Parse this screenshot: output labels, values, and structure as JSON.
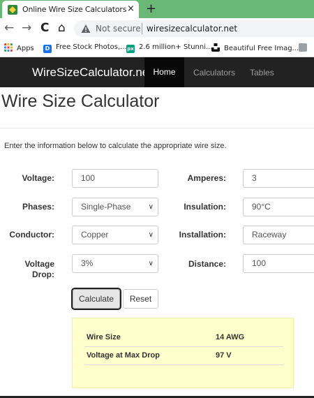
{
  "browser": {
    "tab_title": "Online Wire Size Calculators & Ta",
    "tab_close": "×",
    "new_tab": "+",
    "nav": {
      "back": "←",
      "forward": "→",
      "reload": "C",
      "home": "⌂"
    },
    "security_label": "Not secure",
    "url": "wiresizecalculator.net",
    "bookmarks": [
      {
        "label": "Apps",
        "icon": "apps-grid-icon",
        "color": "#e37400"
      },
      {
        "label": "Free Stock Photos,...",
        "icon": "d-favicon",
        "color": "#1a73e8"
      },
      {
        "label": "2.6 million+ Stunni...",
        "icon": "px-favicon",
        "color": "#05a081"
      },
      {
        "label": "Beautiful Free Imag...",
        "icon": "unsplash-favicon",
        "color": "#111111"
      }
    ]
  },
  "site": {
    "brand": "WireSizeCalculator.net",
    "nav": {
      "home": "Home",
      "calculators": "Calculators",
      "tables": "Tables"
    }
  },
  "page": {
    "title": "Wire Size Calculator",
    "intro": "Enter the information below to calculate the appropriate wire size."
  },
  "form": {
    "voltage": {
      "label": "Voltage:",
      "value": "100"
    },
    "amperes": {
      "label": "Amperes:",
      "value": "3"
    },
    "phases": {
      "label": "Phases:",
      "value": "Single-Phase"
    },
    "insulation": {
      "label": "Insulation:",
      "value": "90°C"
    },
    "conductor": {
      "label": "Conductor:",
      "value": "Copper"
    },
    "installation": {
      "label": "Installation:",
      "value": "Raceway"
    },
    "voltage_drop": {
      "label_line1": "Voltage",
      "label_line2": "Drop:",
      "value": "3%"
    },
    "distance": {
      "label": "Distance:",
      "value": "100"
    },
    "calculate_label": "Calculate",
    "reset_label": "Reset"
  },
  "results": [
    {
      "label": "Wire Size",
      "value": "14 AWG"
    },
    {
      "label": "Voltage at Max Drop",
      "value": "97 V"
    }
  ],
  "colors": {
    "tabstrip": "#69b876",
    "navbar": "#222222",
    "result_bg": "#ffffcc"
  }
}
